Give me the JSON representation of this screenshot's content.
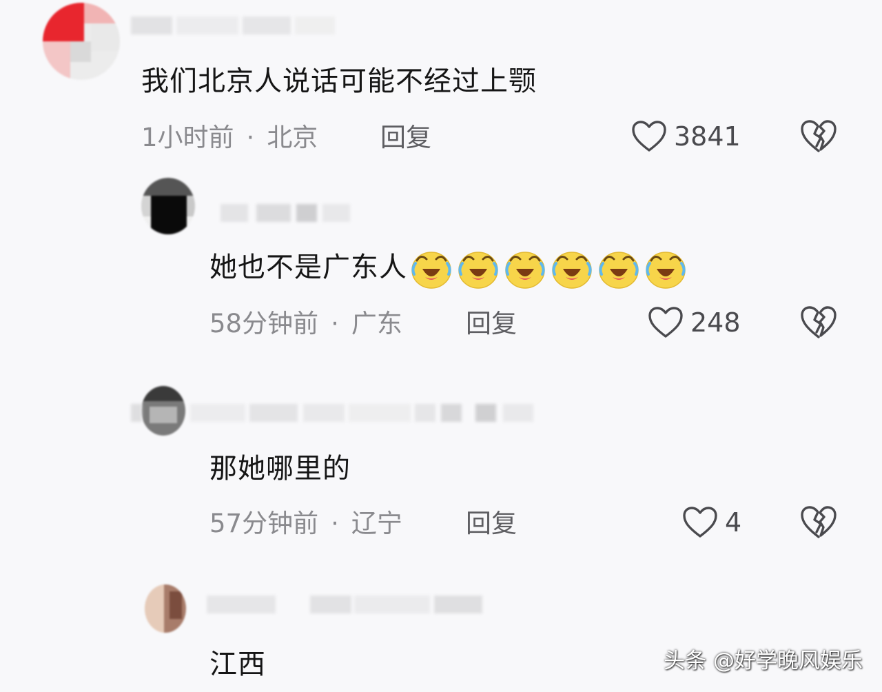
{
  "comments": [
    {
      "text": "我们北京人说话可能不经过上颚",
      "time": "1小时前",
      "location": "北京",
      "reply_label": "回复",
      "likes": "3841",
      "is_reply": false
    },
    {
      "text": "她也不是广东人",
      "emoji_count": 6,
      "emoji_name": "crying-laughing-emoji",
      "time": "58分钟前",
      "location": "广东",
      "reply_label": "回复",
      "likes": "248",
      "is_reply": true
    },
    {
      "text": "那她哪里的",
      "time": "57分钟前",
      "location": "辽宁",
      "reply_label": "回复",
      "likes": "4",
      "is_reply": true
    },
    {
      "text": "江西",
      "is_reply": true
    }
  ],
  "separator": "·",
  "icons": {
    "like": "heart-outline-icon",
    "dislike": "broken-heart-icon"
  },
  "watermark": "头条 @好学晚风娱乐",
  "colors": {
    "background": "#f8f8fa",
    "meta_text": "#8a8a8e",
    "emoji_face": "#f7d54a"
  }
}
